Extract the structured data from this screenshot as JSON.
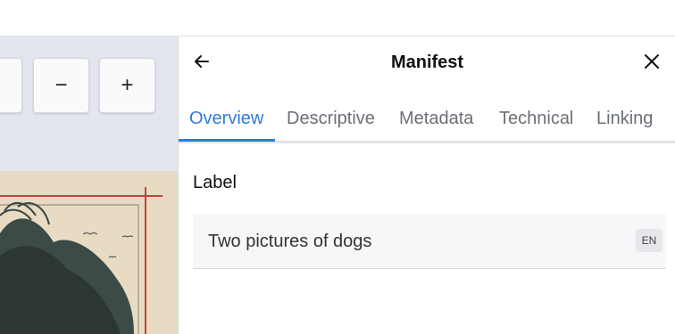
{
  "viewer": {
    "toolbar": {
      "zoom_out_symbol": "−",
      "zoom_in_symbol": "+"
    }
  },
  "panel": {
    "title": "Manifest",
    "back_icon": "arrow-left-icon",
    "close_icon": "close-icon",
    "tabs": [
      {
        "label": "Overview",
        "active": true
      },
      {
        "label": "Descriptive",
        "active": false
      },
      {
        "label": "Metadata",
        "active": false
      },
      {
        "label": "Technical",
        "active": false
      },
      {
        "label": "Linking",
        "active": false
      }
    ],
    "label_section": {
      "heading": "Label",
      "value": "Two pictures of dogs",
      "language": "EN"
    }
  },
  "colors": {
    "accent": "#2f7bdc",
    "toolbar_bg": "#e3e6ee"
  }
}
